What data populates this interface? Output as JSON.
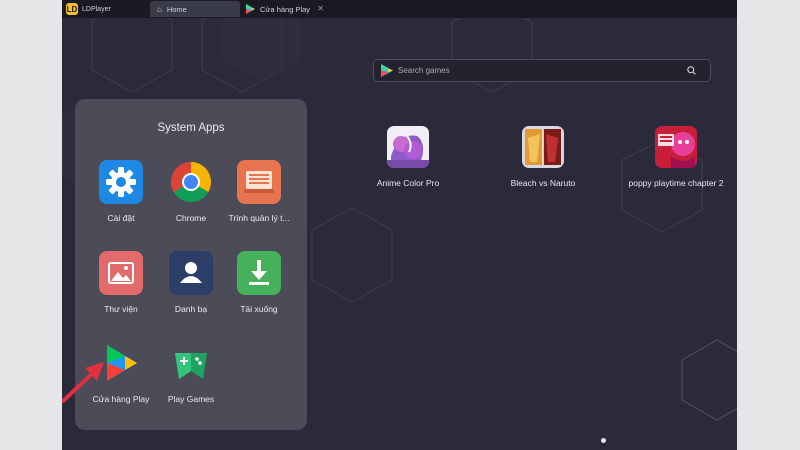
{
  "window": {
    "app_name": "LDPlayer",
    "tabs": [
      {
        "label": "Home",
        "icon": "home-icon",
        "active": true
      },
      {
        "label": "Cửa hàng Play",
        "icon": "play-store-icon",
        "active": false
      }
    ]
  },
  "search": {
    "placeholder": "Search games"
  },
  "games": [
    {
      "label": "Anime Color Pro"
    },
    {
      "label": "Bleach vs Naruto"
    },
    {
      "label": "poppy playtime chapter 2"
    }
  ],
  "folder": {
    "title": "System Apps",
    "apps": [
      {
        "label": "Cài đặt",
        "icon": "settings-gear-icon",
        "color": "#1e88e5"
      },
      {
        "label": "Chrome",
        "icon": "chrome-icon",
        "color": "#ffffff"
      },
      {
        "label": "Trình quản lý t...",
        "icon": "file-manager-icon",
        "color": "#e8734f"
      },
      {
        "label": "Thư viện",
        "icon": "gallery-icon",
        "color": "#e36a6a"
      },
      {
        "label": "Danh bạ",
        "icon": "contacts-icon",
        "color": "#2d3e69"
      },
      {
        "label": "Tải xuống",
        "icon": "download-icon",
        "color": "#45b25b"
      },
      {
        "label": "Cửa hàng Play",
        "icon": "play-store-icon",
        "color": "#00c853"
      },
      {
        "label": "Play Games",
        "icon": "play-games-icon",
        "color": "#1ea362"
      }
    ]
  },
  "colors": {
    "screen_bg": "#2a2a3a",
    "titlebar_bg": "#1a1a22",
    "folder_bg": "#4b4c58",
    "annotation_arrow": "#e03040"
  },
  "pager": {
    "pages": 1,
    "current": 1
  }
}
